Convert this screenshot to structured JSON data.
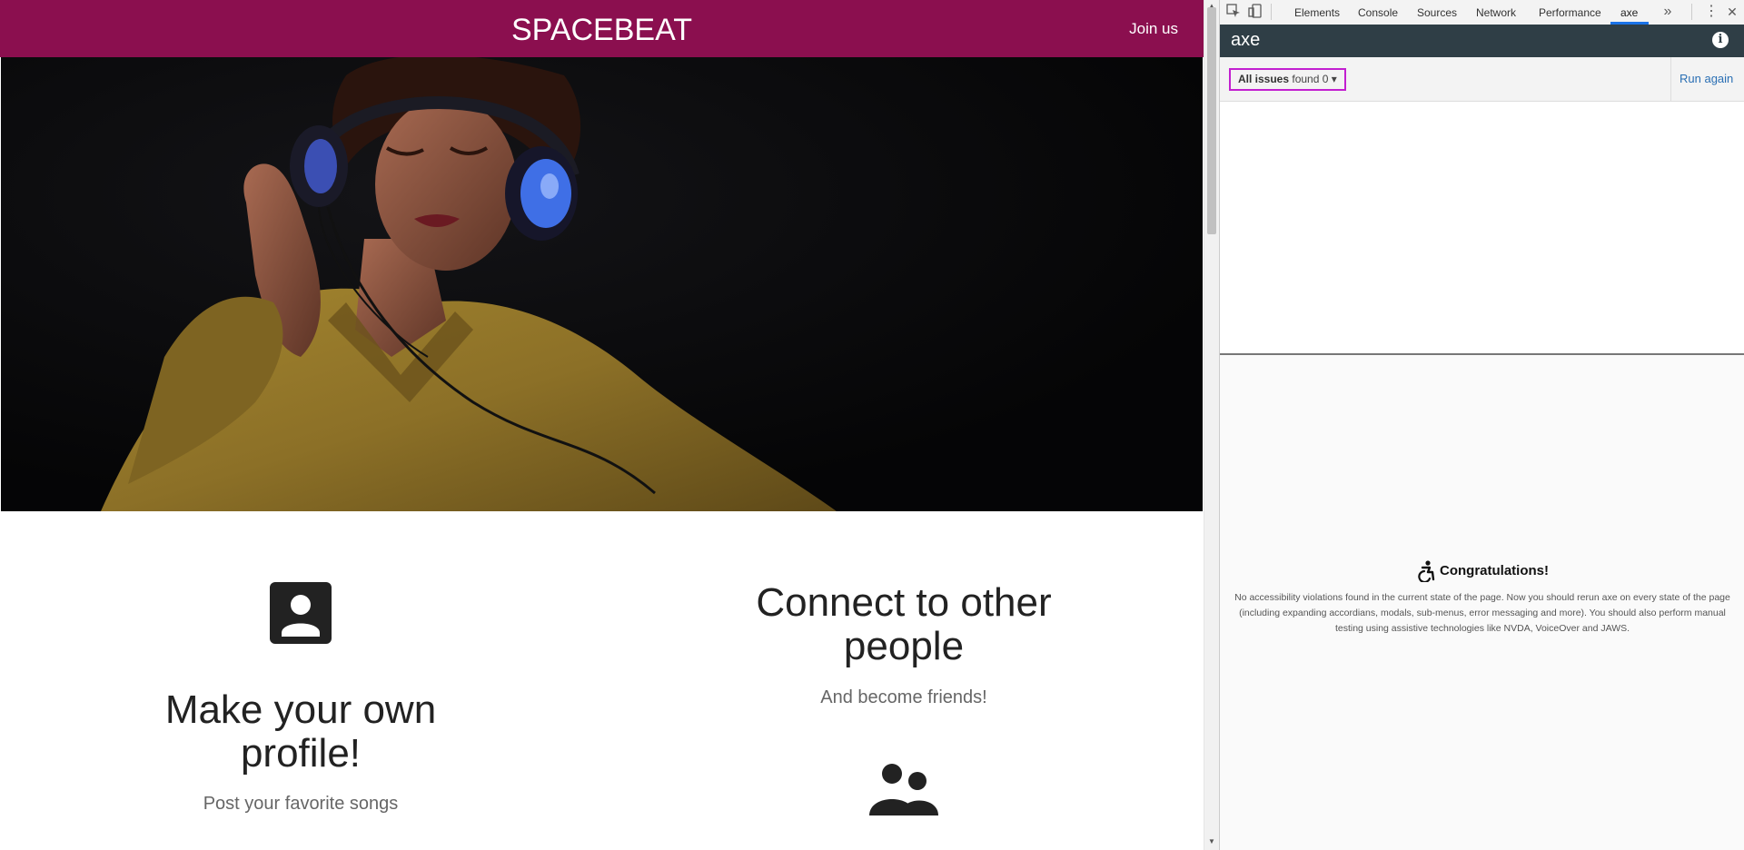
{
  "site": {
    "brand": "SPACEBEAT",
    "join_label": "Join us"
  },
  "features": [
    {
      "title": "Make your own profile!",
      "subtitle": "Post your favorite songs",
      "icon": "person-icon"
    },
    {
      "title": "Connect to other people",
      "subtitle": "And become friends!",
      "icon": "people-icon"
    }
  ],
  "devtools": {
    "tabs": [
      "Elements",
      "Console",
      "Sources",
      "Network",
      "Performance",
      "axe"
    ],
    "active_tab": "axe",
    "more_tabs_symbol": "»",
    "menu_symbol": "⋮",
    "close_symbol": "✕"
  },
  "axe": {
    "title": "axe",
    "filter_label": "All issues",
    "filter_found": "found 0",
    "run_again": "Run again",
    "congrats_title": "Congratulations!",
    "congrats_text": "No accessibility violations found in the current state of the page. Now you should rerun axe on every state of the page (including expanding accordians, modals, sub-menus, error messaging and more). You should also perform manual testing using assistive technologies like NVDA, VoiceOver and JAWS."
  },
  "colors": {
    "header_bg": "#8b0f4f",
    "axe_header_bg": "#2f3e46",
    "filter_border": "#c21fd0",
    "link_blue": "#2a6fb4"
  }
}
